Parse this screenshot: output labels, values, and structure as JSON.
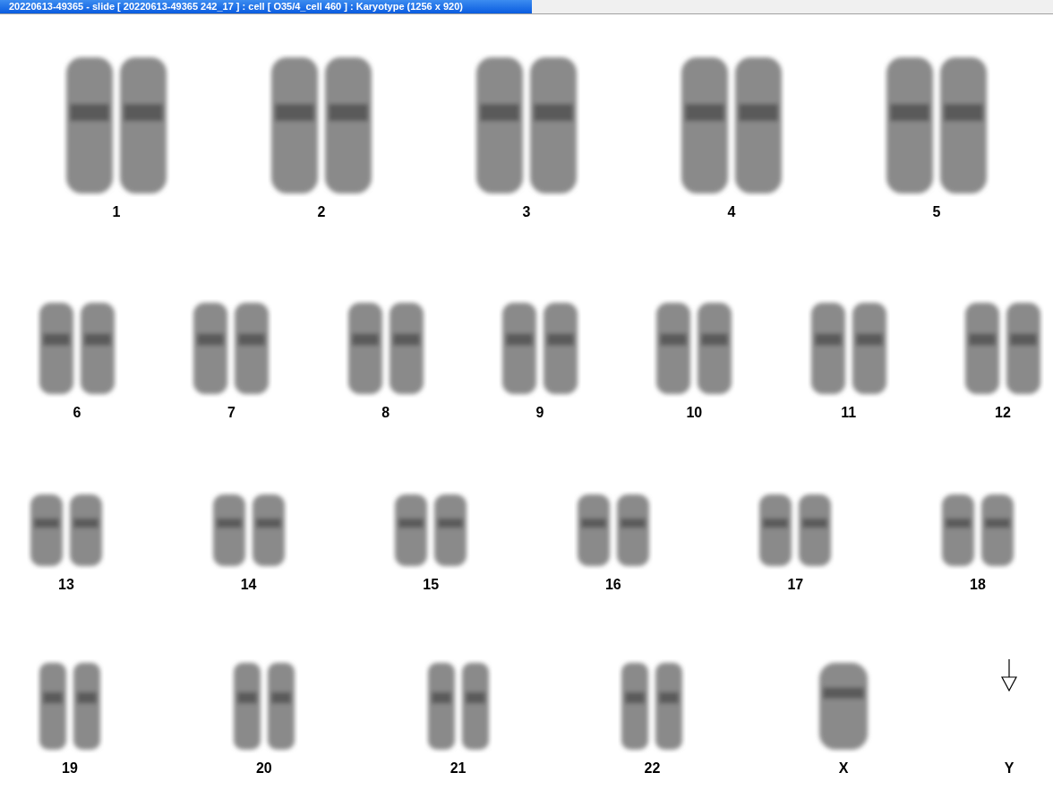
{
  "window": {
    "title": "20220613-49365 - slide [ 20220613-49365 242_17 ] : cell [ O35/4_cell 460 ] : Karyotype  (1256 x 920)"
  },
  "rows": [
    {
      "items": [
        {
          "label": "1",
          "kind": "pair"
        },
        {
          "label": "2",
          "kind": "pair"
        },
        {
          "label": "3",
          "kind": "pair"
        },
        {
          "label": "4",
          "kind": "pair"
        },
        {
          "label": "5",
          "kind": "pair"
        }
      ]
    },
    {
      "items": [
        {
          "label": "6",
          "kind": "pair"
        },
        {
          "label": "7",
          "kind": "pair"
        },
        {
          "label": "8",
          "kind": "pair"
        },
        {
          "label": "9",
          "kind": "pair"
        },
        {
          "label": "10",
          "kind": "pair"
        },
        {
          "label": "11",
          "kind": "pair"
        },
        {
          "label": "12",
          "kind": "pair"
        }
      ]
    },
    {
      "items": [
        {
          "label": "13",
          "kind": "pair"
        },
        {
          "label": "14",
          "kind": "pair"
        },
        {
          "label": "15",
          "kind": "pair"
        },
        {
          "label": "16",
          "kind": "pair"
        },
        {
          "label": "17",
          "kind": "pair"
        },
        {
          "label": "18",
          "kind": "pair"
        }
      ]
    },
    {
      "items": [
        {
          "label": "19",
          "kind": "pair"
        },
        {
          "label": "20",
          "kind": "pair"
        },
        {
          "label": "21",
          "kind": "pair"
        },
        {
          "label": "22",
          "kind": "pair"
        },
        {
          "label": "X",
          "kind": "single"
        },
        {
          "label": "Y",
          "kind": "marker"
        }
      ]
    }
  ]
}
